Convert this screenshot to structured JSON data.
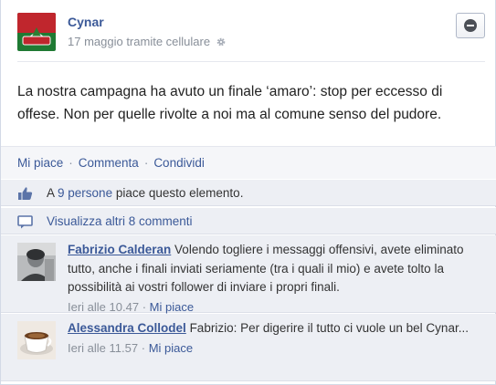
{
  "post": {
    "author": "Cynar",
    "date": "17 maggio tramite cellulare",
    "message": "La nostra campagna ha avuto un finale ‘amaro’: stop per eccesso di offese. Non per quelle rivolte a noi ma al comune senso del pudore.",
    "avatar_logo_text": "Cynar"
  },
  "actions": {
    "like": "Mi piace",
    "sep1": "·",
    "comment": "Commenta",
    "sep2": "·",
    "share": "Condividi"
  },
  "likes": {
    "prefix": "A",
    "count_link": "9 persone",
    "suffix": "piace questo elemento."
  },
  "view_more": {
    "label": "Visualizza altri 8 commenti"
  },
  "comments": [
    {
      "author": "Fabrizio Calderan",
      "text": "Volendo togliere i messaggi offensivi, avete eliminato tutto, anche i finali inviati seriamente (tra i quali il mio) e avete tolto la possibilità ai vostri follower di inviare i propri finali.",
      "time": "Ieri alle 10.47",
      "sep": "·",
      "like": "Mi piace"
    },
    {
      "author": "Alessandra Collodel",
      "text": "Fabrizio: Per digerire il tutto ci vuole un bel Cynar...",
      "time": "Ieri alle 11.57",
      "sep": "·",
      "like": "Mi piace"
    }
  ],
  "colors": {
    "link": "#3b5998",
    "meta": "#888f99",
    "panel": "#edeff4",
    "brand_red": "#c0262d",
    "brand_green": "#2e7d32"
  },
  "icons": {
    "privacy": "gear-icon",
    "options": "minus-circle-icon",
    "likes": "thumbs-up-icon",
    "comments": "comment-bubble-icon"
  }
}
